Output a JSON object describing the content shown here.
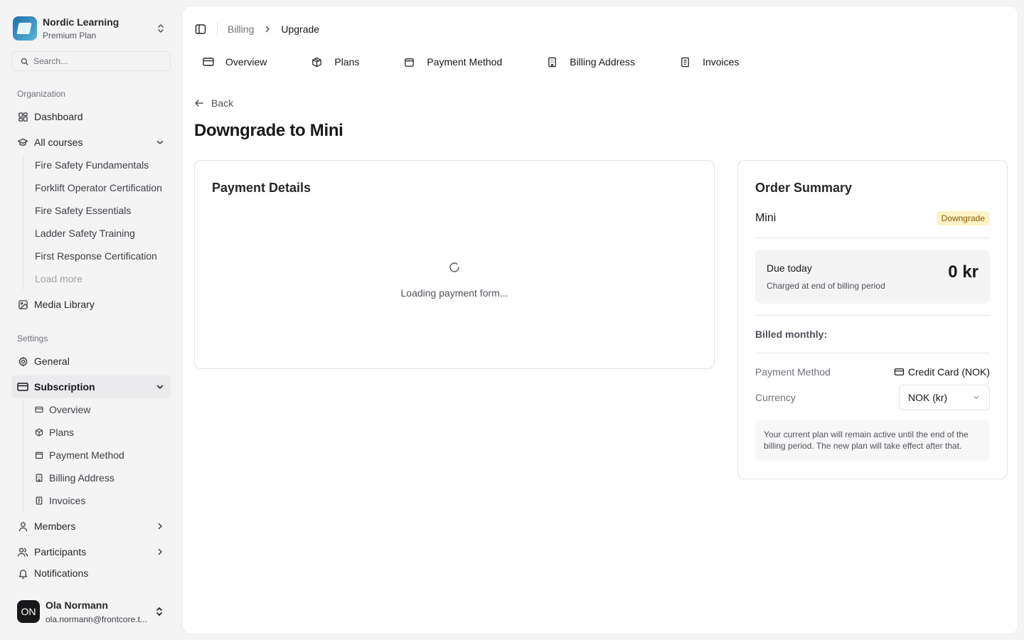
{
  "org": {
    "name": "Nordic Learning",
    "plan": "Premium Plan"
  },
  "search": {
    "placeholder": "Search..."
  },
  "sidebar": {
    "organization_label": "Organization",
    "dashboard": "Dashboard",
    "all_courses": "All courses",
    "courses": [
      "Fire Safety Fundamentals",
      "Forklift Operator Certification",
      "Fire Safety Essentials",
      "Ladder Safety Training",
      "First Response Certification"
    ],
    "load_more": "Load more",
    "media_library": "Media Library",
    "settings_label": "Settings",
    "general": "General",
    "subscription": "Subscription",
    "subscription_items": [
      "Overview",
      "Plans",
      "Payment Method",
      "Billing Address",
      "Invoices"
    ],
    "members": "Members",
    "participants": "Participants",
    "notifications": "Notifications"
  },
  "user": {
    "initials": "ON",
    "name": "Ola Normann",
    "email": "ola.normann@frontcore.t..."
  },
  "breadcrumb": {
    "parent": "Billing",
    "current": "Upgrade"
  },
  "tabs": [
    {
      "label": "Overview",
      "icon": "credit-card-icon"
    },
    {
      "label": "Plans",
      "icon": "package-icon"
    },
    {
      "label": "Payment Method",
      "icon": "wallet-icon"
    },
    {
      "label": "Billing Address",
      "icon": "building-icon"
    },
    {
      "label": "Invoices",
      "icon": "receipt-icon"
    }
  ],
  "back_label": "Back",
  "page_title": "Downgrade to Mini",
  "payment_details": {
    "title": "Payment Details",
    "loading_text": "Loading payment form..."
  },
  "order_summary": {
    "title": "Order Summary",
    "plan_name": "Mini",
    "badge": "Downgrade",
    "due_label": "Due today",
    "due_sub": "Charged at end of billing period",
    "due_amount": "0 kr",
    "billed": "Billed monthly:",
    "payment_method_label": "Payment Method",
    "payment_method_value": "Credit Card (NOK)",
    "currency_label": "Currency",
    "currency_value": "NOK (kr)",
    "note": "Your current plan will remain active until the end of the billing period. The new plan will take effect after that."
  },
  "colors": {
    "badge_bg": "#fdf2c4",
    "badge_text": "#8a5a0c",
    "active_bg": "#ebebed"
  }
}
